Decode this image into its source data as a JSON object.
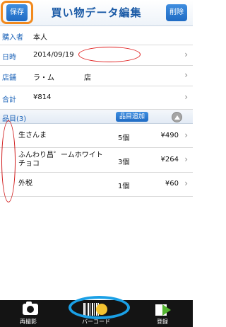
{
  "header": {
    "save_label": "保存",
    "title": "買い物データ編集",
    "delete_label": "削除"
  },
  "fields": [
    {
      "label": "購入者",
      "value": "本人",
      "chevron": false
    },
    {
      "label": "日時",
      "value": "2014/09/19",
      "chevron": true
    },
    {
      "label": "店舗",
      "value": "ラ・ム",
      "suffix": "店",
      "chevron": true
    },
    {
      "label": "合計",
      "value": "¥814",
      "chevron": true
    }
  ],
  "items_section": {
    "label": "品目(3)",
    "add_label": "品目追加"
  },
  "items": [
    {
      "name": "生さんま",
      "qty": "5個",
      "price": "¥490"
    },
    {
      "name": "ふんわり昌゜ームホワイトチョコ",
      "qty": "3個",
      "price": "¥264"
    },
    {
      "name": "外税",
      "qty": "1個",
      "price": "¥60"
    }
  ],
  "toolbar": {
    "camera_label": "再撮影",
    "barcode_label": "バーコード",
    "register_label": "登録"
  },
  "colors": {
    "accent": "#1f6bc4",
    "label_blue": "#1a62b8",
    "toolbar_bg": "#141414",
    "annotation_orange": "#f28a1e",
    "annotation_red": "#e02020",
    "annotation_blue": "#1aa0e6"
  },
  "icons": {
    "camera": "camera-icon",
    "barcode": "barcode-icon",
    "register": "register-icon",
    "collapse": "collapse-icon",
    "chevron": "chevron-right-icon"
  }
}
